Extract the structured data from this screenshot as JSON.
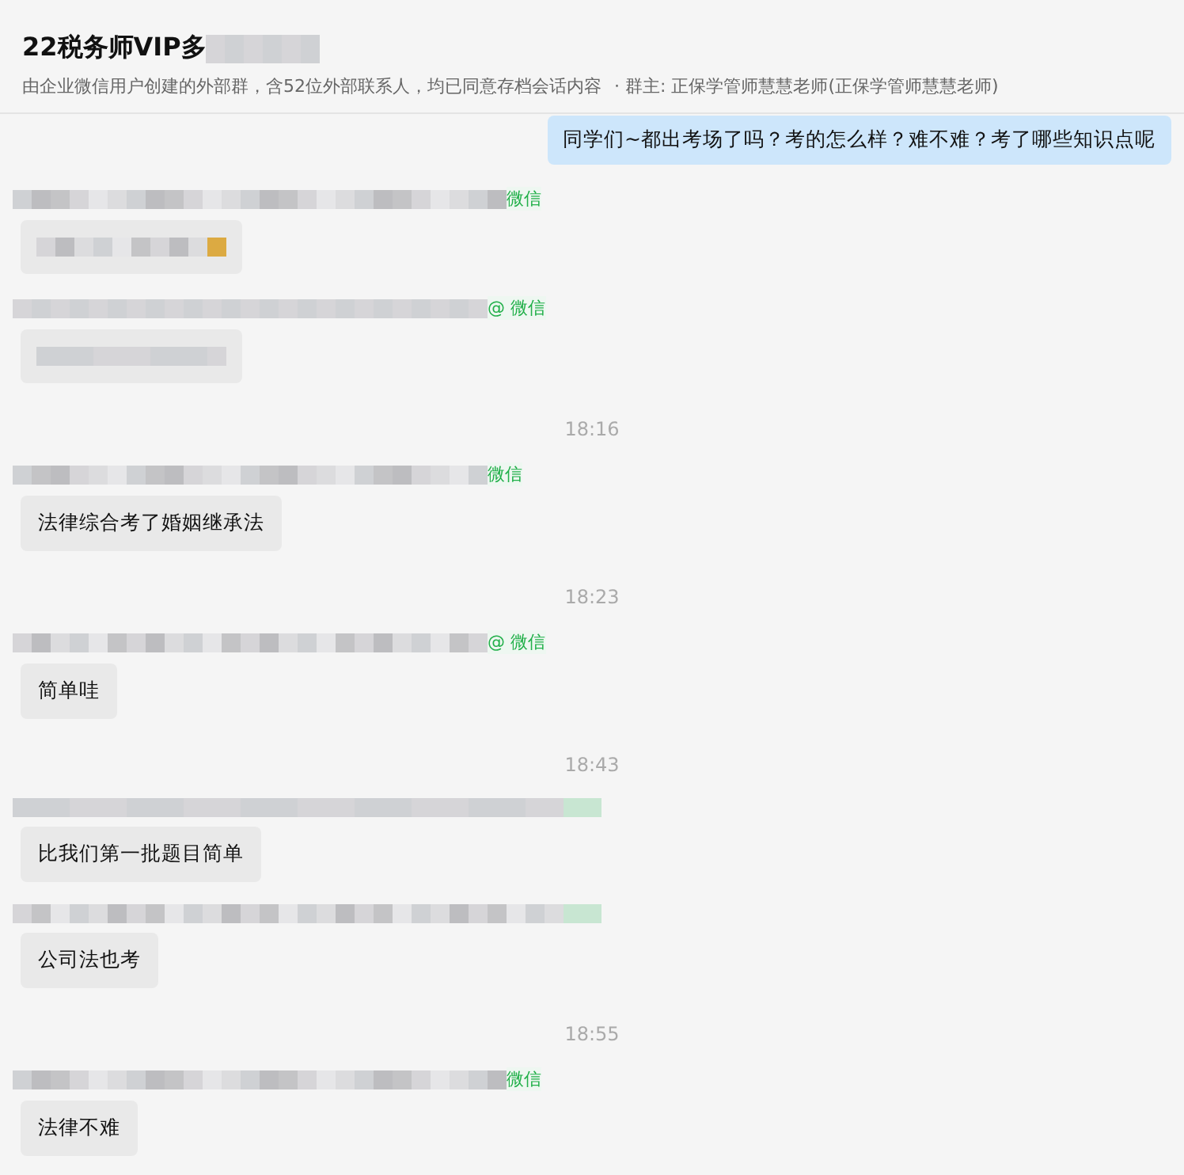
{
  "header": {
    "title": "22税务师VIP多",
    "subtitle": "由企业微信用户创建的外部群，含52位外部联系人，均已同意存档会话内容",
    "owner": "· 群主: 正保学管师慧慧老师(正保学管师慧慧老师)"
  },
  "messages": [
    {
      "kind": "outgoing",
      "text": "同学们~都出考场了吗？考的怎么样？难不难？考了哪些知识点呢"
    },
    {
      "kind": "incoming",
      "suffix": "微信"
    },
    {
      "kind": "incoming",
      "suffix": "@ 微信"
    },
    {
      "kind": "time",
      "text": "18:16"
    },
    {
      "kind": "incoming",
      "suffix": "微信",
      "text": "法律综合考了婚姻继承法"
    },
    {
      "kind": "time",
      "text": "18:23"
    },
    {
      "kind": "incoming",
      "suffix": "@ 微信",
      "text": "简单哇"
    },
    {
      "kind": "time",
      "text": "18:43"
    },
    {
      "kind": "incoming",
      "text": "比我们第一批题目简单"
    },
    {
      "kind": "incoming",
      "text": "公司法也考"
    },
    {
      "kind": "time",
      "text": "18:55"
    },
    {
      "kind": "incoming",
      "suffix": "微信",
      "text": "法律不难"
    }
  ]
}
